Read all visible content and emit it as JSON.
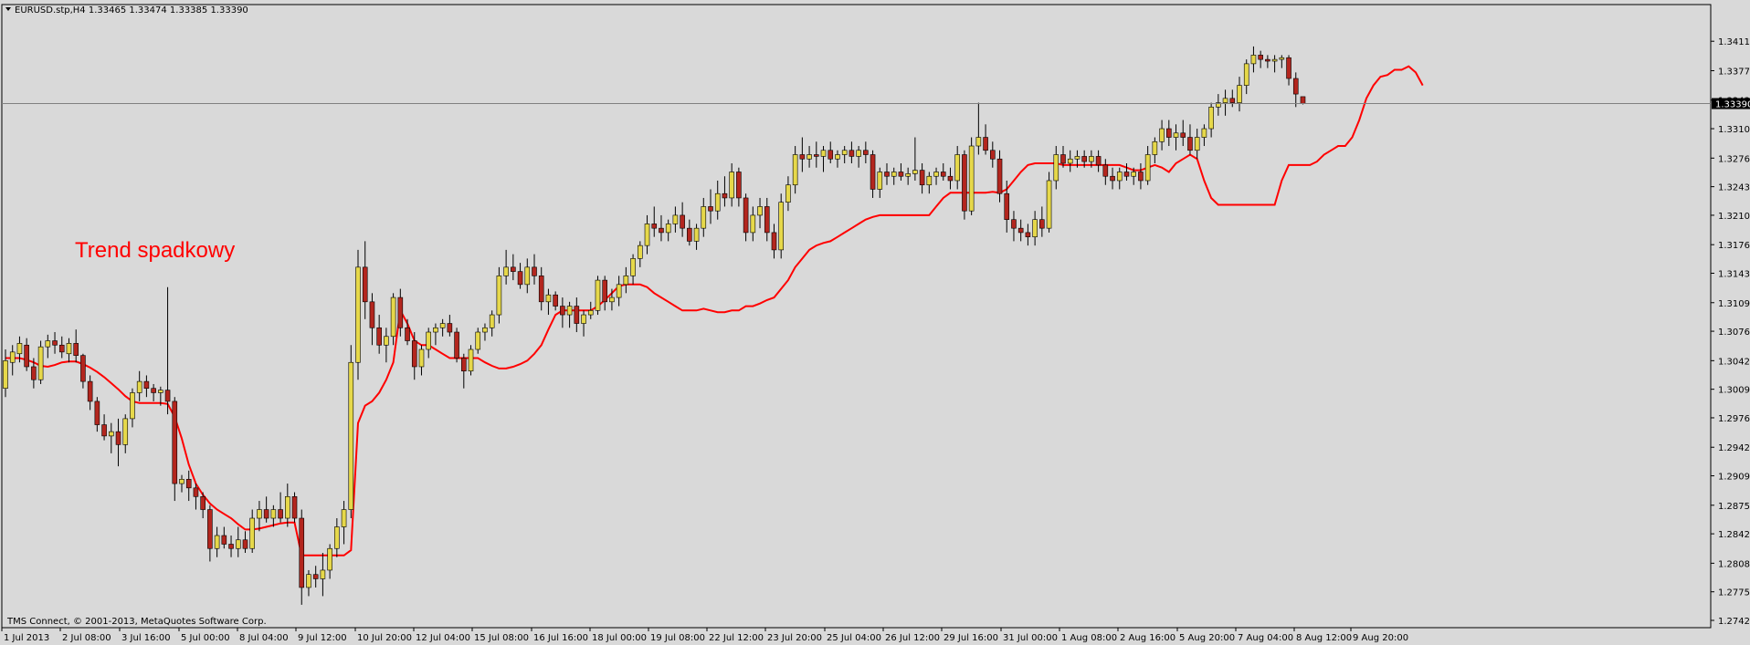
{
  "header": {
    "symbol": "EURUSD.stp,H4",
    "ohlc": "1.33465 1.33474 1.33385 1.33390"
  },
  "copyright": "TMS Connect, © 2001-2013, MetaQuotes Software Corp.",
  "annotation": "Trend spadkowy",
  "colors": {
    "background": "#d9d9d9",
    "bull_body": "#e6d84a",
    "bear_body": "#b3261e",
    "wick": "#000000",
    "moving_average": "#ff0000",
    "price_line": "#808080"
  },
  "chart_data": {
    "type": "candlestick",
    "title": "EURUSD.stp,H4",
    "current_price": "1.33390",
    "ylim": [
      1.2742,
      1.3446
    ],
    "y_ticks": [
      "1.34110",
      "1.33770",
      "1.33430",
      "1.33100",
      "1.32760",
      "1.32430",
      "1.32100",
      "1.31760",
      "1.31430",
      "1.31090",
      "1.30760",
      "1.30420",
      "1.30090",
      "1.29760",
      "1.29420",
      "1.29090",
      "1.28750",
      "1.28420",
      "1.28080",
      "1.27750",
      "1.27420"
    ],
    "x_ticks": [
      "1 Jul 2013",
      "2 Jul 08:00",
      "3 Jul 16:00",
      "5 Jul 00:00",
      "8 Jul 04:00",
      "9 Jul 12:00",
      "10 Jul 20:00",
      "12 Jul 04:00",
      "15 Jul 08:00",
      "16 Jul 16:00",
      "18 Jul 00:00",
      "19 Jul 08:00",
      "22 Jul 12:00",
      "23 Jul 20:00",
      "25 Jul 04:00",
      "26 Jul 12:00",
      "29 Jul 16:00",
      "31 Jul 00:00",
      "1 Aug 08:00",
      "2 Aug 16:00",
      "5 Aug 20:00",
      "7 Aug 04:00",
      "8 Aug 12:00",
      "9 Aug 20:00"
    ],
    "candles": [
      [
        1.301,
        1.3055,
        1.3,
        1.3042
      ],
      [
        1.304,
        1.306,
        1.3025,
        1.3052
      ],
      [
        1.305,
        1.307,
        1.304,
        1.3062
      ],
      [
        1.306,
        1.3068,
        1.303,
        1.3035
      ],
      [
        1.3035,
        1.3045,
        1.301,
        1.302
      ],
      [
        1.302,
        1.3065,
        1.3015,
        1.3058
      ],
      [
        1.3058,
        1.3072,
        1.3045,
        1.3065
      ],
      [
        1.3065,
        1.3075,
        1.305,
        1.306
      ],
      [
        1.306,
        1.307,
        1.3045,
        1.3052
      ],
      [
        1.305,
        1.3068,
        1.304,
        1.3062
      ],
      [
        1.3062,
        1.3078,
        1.304,
        1.3048
      ],
      [
        1.3048,
        1.305,
        1.301,
        1.3018
      ],
      [
        1.3018,
        1.3025,
        1.2985,
        1.2995
      ],
      [
        1.2995,
        1.3,
        1.296,
        1.2968
      ],
      [
        1.2968,
        1.298,
        1.295,
        1.2955
      ],
      [
        1.2955,
        1.297,
        1.2935,
        1.296
      ],
      [
        1.296,
        1.2975,
        1.292,
        1.2945
      ],
      [
        1.2945,
        1.298,
        1.2935,
        1.2975
      ],
      [
        1.2975,
        1.301,
        1.2965,
        1.3005
      ],
      [
        1.3005,
        1.303,
        1.2995,
        1.3018
      ],
      [
        1.3018,
        1.3025,
        1.3,
        1.301
      ],
      [
        1.301,
        1.3015,
        1.2995,
        1.3005
      ],
      [
        1.3005,
        1.3012,
        1.299,
        1.3008
      ],
      [
        1.3008,
        1.3127,
        1.298,
        1.2995
      ],
      [
        1.2995,
        1.3,
        1.288,
        1.29
      ],
      [
        1.29,
        1.291,
        1.289,
        1.2905
      ],
      [
        1.2905,
        1.2915,
        1.288,
        1.2895
      ],
      [
        1.2895,
        1.29,
        1.287,
        1.2885
      ],
      [
        1.2885,
        1.289,
        1.286,
        1.287
      ],
      [
        1.287,
        1.2875,
        1.281,
        1.2825
      ],
      [
        1.2825,
        1.285,
        1.2815,
        1.284
      ],
      [
        1.284,
        1.285,
        1.2825,
        1.283
      ],
      [
        1.283,
        1.284,
        1.2815,
        1.2825
      ],
      [
        1.2825,
        1.285,
        1.2815,
        1.2835
      ],
      [
        1.2835,
        1.2845,
        1.282,
        1.2825
      ],
      [
        1.2825,
        1.287,
        1.282,
        1.286
      ],
      [
        1.286,
        1.288,
        1.2845,
        1.287
      ],
      [
        1.287,
        1.2885,
        1.2855,
        1.286
      ],
      [
        1.286,
        1.2875,
        1.285,
        1.287
      ],
      [
        1.287,
        1.289,
        1.2855,
        1.286
      ],
      [
        1.286,
        1.29,
        1.285,
        1.2885
      ],
      [
        1.2885,
        1.289,
        1.2855,
        1.286
      ],
      [
        1.286,
        1.287,
        1.276,
        1.278
      ],
      [
        1.278,
        1.28,
        1.277,
        1.2795
      ],
      [
        1.2795,
        1.2805,
        1.278,
        1.279
      ],
      [
        1.279,
        1.282,
        1.277,
        1.28
      ],
      [
        1.28,
        1.283,
        1.279,
        1.2825
      ],
      [
        1.2825,
        1.286,
        1.2815,
        1.285
      ],
      [
        1.285,
        1.288,
        1.283,
        1.287
      ],
      [
        1.287,
        1.306,
        1.286,
        1.304
      ],
      [
        1.304,
        1.317,
        1.302,
        1.315
      ],
      [
        1.315,
        1.318,
        1.309,
        1.311
      ],
      [
        1.311,
        1.312,
        1.306,
        1.308
      ],
      [
        1.308,
        1.3095,
        1.305,
        1.306
      ],
      [
        1.306,
        1.308,
        1.304,
        1.307
      ],
      [
        1.307,
        1.312,
        1.306,
        1.3115
      ],
      [
        1.3115,
        1.3125,
        1.307,
        1.308
      ],
      [
        1.308,
        1.309,
        1.306,
        1.3065
      ],
      [
        1.3065,
        1.3075,
        1.302,
        1.3035
      ],
      [
        1.3035,
        1.306,
        1.3025,
        1.3055
      ],
      [
        1.3055,
        1.308,
        1.3045,
        1.3075
      ],
      [
        1.3075,
        1.3085,
        1.306,
        1.308
      ],
      [
        1.308,
        1.309,
        1.307,
        1.3085
      ],
      [
        1.3085,
        1.3095,
        1.307,
        1.3075
      ],
      [
        1.3075,
        1.308,
        1.304,
        1.3045
      ],
      [
        1.3045,
        1.305,
        1.301,
        1.303
      ],
      [
        1.303,
        1.306,
        1.3025,
        1.3055
      ],
      [
        1.3055,
        1.308,
        1.305,
        1.3075
      ],
      [
        1.3075,
        1.3085,
        1.3065,
        1.308
      ],
      [
        1.308,
        1.31,
        1.307,
        1.3095
      ],
      [
        1.3095,
        1.315,
        1.3085,
        1.314
      ],
      [
        1.314,
        1.317,
        1.313,
        1.315
      ],
      [
        1.315,
        1.3165,
        1.3135,
        1.3145
      ],
      [
        1.3145,
        1.3155,
        1.3125,
        1.313
      ],
      [
        1.313,
        1.316,
        1.312,
        1.315
      ],
      [
        1.315,
        1.3165,
        1.313,
        1.314
      ],
      [
        1.314,
        1.315,
        1.31,
        1.311
      ],
      [
        1.311,
        1.3125,
        1.3095,
        1.3118
      ],
      [
        1.3118,
        1.3122,
        1.31,
        1.3105
      ],
      [
        1.3105,
        1.3115,
        1.308,
        1.3095
      ],
      [
        1.3095,
        1.311,
        1.308,
        1.3105
      ],
      [
        1.3105,
        1.3115,
        1.3075,
        1.3085
      ],
      [
        1.3085,
        1.31,
        1.307,
        1.3095
      ],
      [
        1.3095,
        1.311,
        1.309,
        1.31
      ],
      [
        1.31,
        1.314,
        1.3095,
        1.3135
      ],
      [
        1.3135,
        1.314,
        1.31,
        1.311
      ],
      [
        1.311,
        1.3125,
        1.31,
        1.3115
      ],
      [
        1.3115,
        1.314,
        1.3105,
        1.313
      ],
      [
        1.313,
        1.315,
        1.312,
        1.314
      ],
      [
        1.314,
        1.3165,
        1.313,
        1.316
      ],
      [
        1.316,
        1.318,
        1.315,
        1.3175
      ],
      [
        1.3175,
        1.321,
        1.3165,
        1.32
      ],
      [
        1.32,
        1.322,
        1.3185,
        1.3195
      ],
      [
        1.3195,
        1.321,
        1.318,
        1.319
      ],
      [
        1.319,
        1.3205,
        1.318,
        1.32
      ],
      [
        1.32,
        1.322,
        1.319,
        1.321
      ],
      [
        1.321,
        1.3225,
        1.3185,
        1.3195
      ],
      [
        1.3195,
        1.3205,
        1.3175,
        1.318
      ],
      [
        1.318,
        1.32,
        1.317,
        1.3195
      ],
      [
        1.3195,
        1.323,
        1.3185,
        1.322
      ],
      [
        1.322,
        1.324,
        1.32,
        1.3215
      ],
      [
        1.3215,
        1.325,
        1.3205,
        1.3235
      ],
      [
        1.3235,
        1.3255,
        1.322,
        1.323
      ],
      [
        1.323,
        1.327,
        1.322,
        1.326
      ],
      [
        1.326,
        1.3265,
        1.322,
        1.323
      ],
      [
        1.323,
        1.3235,
        1.318,
        1.319
      ],
      [
        1.319,
        1.322,
        1.318,
        1.321
      ],
      [
        1.321,
        1.323,
        1.3195,
        1.322
      ],
      [
        1.322,
        1.323,
        1.318,
        1.319
      ],
      [
        1.319,
        1.32,
        1.316,
        1.317
      ],
      [
        1.317,
        1.3235,
        1.316,
        1.3225
      ],
      [
        1.3225,
        1.3255,
        1.3215,
        1.3245
      ],
      [
        1.3245,
        1.329,
        1.3235,
        1.328
      ],
      [
        1.328,
        1.33,
        1.326,
        1.3275
      ],
      [
        1.3275,
        1.329,
        1.3265,
        1.328
      ],
      [
        1.328,
        1.3295,
        1.3265,
        1.3278
      ],
      [
        1.3278,
        1.329,
        1.326,
        1.3285
      ],
      [
        1.3285,
        1.3295,
        1.327,
        1.3275
      ],
      [
        1.3275,
        1.3285,
        1.3265,
        1.328
      ],
      [
        1.328,
        1.329,
        1.327,
        1.3285
      ],
      [
        1.3285,
        1.3295,
        1.327,
        1.3278
      ],
      [
        1.3278,
        1.329,
        1.3265,
        1.3285
      ],
      [
        1.3285,
        1.3295,
        1.327,
        1.328
      ],
      [
        1.328,
        1.3285,
        1.323,
        1.324
      ],
      [
        1.324,
        1.3265,
        1.323,
        1.326
      ],
      [
        1.326,
        1.327,
        1.3245,
        1.3255
      ],
      [
        1.3255,
        1.3265,
        1.3245,
        1.326
      ],
      [
        1.326,
        1.327,
        1.325,
        1.3255
      ],
      [
        1.3255,
        1.3265,
        1.3245,
        1.3258
      ],
      [
        1.3258,
        1.33,
        1.325,
        1.3262
      ],
      [
        1.3262,
        1.327,
        1.3235,
        1.3245
      ],
      [
        1.3245,
        1.326,
        1.3235,
        1.3255
      ],
      [
        1.3255,
        1.3265,
        1.3245,
        1.326
      ],
      [
        1.326,
        1.327,
        1.325,
        1.3255
      ],
      [
        1.3255,
        1.3265,
        1.324,
        1.325
      ],
      [
        1.325,
        1.329,
        1.324,
        1.328
      ],
      [
        1.328,
        1.3285,
        1.3205,
        1.3215
      ],
      [
        1.3215,
        1.33,
        1.321,
        1.329
      ],
      [
        1.329,
        1.334,
        1.328,
        1.33
      ],
      [
        1.33,
        1.3315,
        1.328,
        1.3285
      ],
      [
        1.3285,
        1.3295,
        1.3265,
        1.3275
      ],
      [
        1.3275,
        1.3285,
        1.3225,
        1.3235
      ],
      [
        1.3235,
        1.325,
        1.319,
        1.3205
      ],
      [
        1.3205,
        1.3215,
        1.318,
        1.3195
      ],
      [
        1.3195,
        1.3205,
        1.318,
        1.319
      ],
      [
        1.319,
        1.32,
        1.3175,
        1.3185
      ],
      [
        1.3185,
        1.3215,
        1.3175,
        1.3205
      ],
      [
        1.3205,
        1.322,
        1.3185,
        1.3195
      ],
      [
        1.3195,
        1.326,
        1.319,
        1.325
      ],
      [
        1.325,
        1.329,
        1.324,
        1.328
      ],
      [
        1.328,
        1.329,
        1.3265,
        1.327
      ],
      [
        1.327,
        1.3285,
        1.326,
        1.3275
      ],
      [
        1.3275,
        1.3285,
        1.3265,
        1.3278
      ],
      [
        1.3278,
        1.3285,
        1.3265,
        1.3272
      ],
      [
        1.3272,
        1.3285,
        1.3265,
        1.3278
      ],
      [
        1.3278,
        1.3285,
        1.326,
        1.3268
      ],
      [
        1.3268,
        1.3275,
        1.3245,
        1.3255
      ],
      [
        1.3255,
        1.3265,
        1.324,
        1.325
      ],
      [
        1.325,
        1.3265,
        1.324,
        1.326
      ],
      [
        1.326,
        1.327,
        1.325,
        1.3255
      ],
      [
        1.3255,
        1.3265,
        1.3245,
        1.326
      ],
      [
        1.326,
        1.327,
        1.324,
        1.325
      ],
      [
        1.325,
        1.329,
        1.3245,
        1.328
      ],
      [
        1.328,
        1.33,
        1.327,
        1.3295
      ],
      [
        1.3295,
        1.332,
        1.3285,
        1.331
      ],
      [
        1.331,
        1.332,
        1.329,
        1.33
      ],
      [
        1.33,
        1.3315,
        1.3285,
        1.3305
      ],
      [
        1.3305,
        1.332,
        1.329,
        1.33
      ],
      [
        1.33,
        1.3315,
        1.328,
        1.3285
      ],
      [
        1.3285,
        1.331,
        1.3275,
        1.33
      ],
      [
        1.33,
        1.3315,
        1.329,
        1.331
      ],
      [
        1.331,
        1.334,
        1.33,
        1.3335
      ],
      [
        1.3335,
        1.335,
        1.3325,
        1.334
      ],
      [
        1.334,
        1.3355,
        1.3325,
        1.3345
      ],
      [
        1.3345,
        1.3355,
        1.3335,
        1.334
      ],
      [
        1.334,
        1.337,
        1.333,
        1.336
      ],
      [
        1.336,
        1.339,
        1.335,
        1.3385
      ],
      [
        1.3385,
        1.3405,
        1.3375,
        1.3395
      ],
      [
        1.3395,
        1.34,
        1.338,
        1.339
      ],
      [
        1.339,
        1.3395,
        1.338,
        1.3388
      ],
      [
        1.3388,
        1.3395,
        1.3375,
        1.339
      ],
      [
        1.339,
        1.3395,
        1.338,
        1.3392
      ],
      [
        1.3392,
        1.3395,
        1.336,
        1.3368
      ],
      [
        1.3368,
        1.3375,
        1.3335,
        1.335
      ],
      [
        1.3347,
        1.3347,
        1.3338,
        1.3339
      ]
    ],
    "moving_average": [
      1.3045,
      1.3045,
      1.3045,
      1.3043,
      1.304,
      1.3036,
      1.3035,
      1.3037,
      1.304,
      1.3041,
      1.3041,
      1.3038,
      1.3034,
      1.3029,
      1.3023,
      1.3016,
      1.3009,
      1.3001,
      1.2995,
      1.2993,
      1.2993,
      1.2993,
      1.2993,
      1.2992,
      1.2977,
      1.2952,
      1.2922,
      1.29,
      1.2887,
      1.2877,
      1.287,
      1.2865,
      1.286,
      1.2853,
      1.2847,
      1.2847,
      1.2848,
      1.285,
      1.2852,
      1.2854,
      1.2855,
      1.2855,
      1.2817,
      1.2817,
      1.2817,
      1.2817,
      1.2817,
      1.2817,
      1.2817,
      1.2823,
      1.297,
      1.299,
      1.2995,
      1.3005,
      1.302,
      1.304,
      1.31,
      1.3085,
      1.3065,
      1.306,
      1.306,
      1.3055,
      1.305,
      1.3045,
      1.3045,
      1.3045,
      1.3045,
      1.3045,
      1.304,
      1.3036,
      1.3033,
      1.3033,
      1.3035,
      1.3038,
      1.3042,
      1.305,
      1.306,
      1.3078,
      1.3095,
      1.31,
      1.31,
      1.31,
      1.31,
      1.31,
      1.3105,
      1.3112,
      1.312,
      1.3128,
      1.313,
      1.313,
      1.313,
      1.3127,
      1.312,
      1.3115,
      1.311,
      1.3105,
      1.31,
      1.31,
      1.31,
      1.3102,
      1.31,
      1.3098,
      1.3098,
      1.31,
      1.31,
      1.3105,
      1.3105,
      1.3108,
      1.3112,
      1.3115,
      1.3125,
      1.3135,
      1.315,
      1.316,
      1.317,
      1.3175,
      1.3178,
      1.318,
      1.3185,
      1.319,
      1.3195,
      1.32,
      1.3205,
      1.3208,
      1.321,
      1.321,
      1.321,
      1.321,
      1.321,
      1.321,
      1.321,
      1.321,
      1.322,
      1.323,
      1.3236,
      1.3236,
      1.3236,
      1.3236,
      1.3236,
      1.3236,
      1.3237,
      1.3236,
      1.324,
      1.325,
      1.326,
      1.3268,
      1.327,
      1.327,
      1.327,
      1.327,
      1.3268,
      1.3268,
      1.3268,
      1.3268,
      1.3268,
      1.3268,
      1.3268,
      1.3268,
      1.3268,
      1.3265,
      1.3262,
      1.3262,
      1.3265,
      1.3268,
      1.3265,
      1.326,
      1.327,
      1.3275,
      1.328,
      1.3275,
      1.325,
      1.323,
      1.3222,
      1.3222,
      1.3222,
      1.3222,
      1.3222,
      1.3222,
      1.3222,
      1.3222
    ],
    "ma_tail": [
      1.3222,
      1.325,
      1.3268,
      1.3268,
      1.3268,
      1.3268,
      1.3272,
      1.328,
      1.3285,
      1.329,
      1.329,
      1.33,
      1.332,
      1.3345,
      1.336,
      1.337,
      1.3372,
      1.3378,
      1.3378,
      1.3382,
      1.3375,
      1.336
    ]
  }
}
